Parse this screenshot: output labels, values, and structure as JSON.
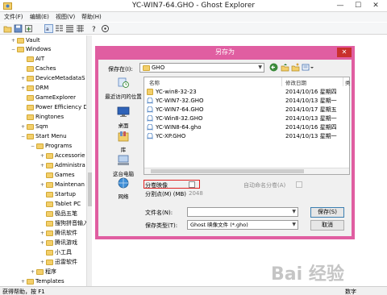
{
  "window": {
    "title": "YC-WIN7-64.GHO - Ghost Explorer",
    "minimize": "—",
    "maximize": "☐",
    "close": "✕"
  },
  "menu": [
    "文件(F)",
    "编辑(E)",
    "视图(V)",
    "帮助(H)"
  ],
  "toolbar_icons": [
    "open-icon",
    "save-icon",
    "extract-icon",
    "large-icons-icon",
    "small-icons-icon",
    "list-icon",
    "details-icon",
    "help-icon",
    "about-icon"
  ],
  "tree": [
    {
      "label": "Vault",
      "exp": "+",
      "indent": 1
    },
    {
      "label": "Windows",
      "exp": "−",
      "indent": 1
    },
    {
      "label": "AIT",
      "exp": "",
      "indent": 2
    },
    {
      "label": "Caches",
      "exp": "",
      "indent": 2
    },
    {
      "label": "DeviceMetadataS",
      "exp": "+",
      "indent": 2
    },
    {
      "label": "DRM",
      "exp": "+",
      "indent": 2
    },
    {
      "label": "GameExplorer",
      "exp": "",
      "indent": 2
    },
    {
      "label": "Power Efficiency D",
      "exp": "",
      "indent": 2
    },
    {
      "label": "Ringtones",
      "exp": "",
      "indent": 2
    },
    {
      "label": "Sqm",
      "exp": "+",
      "indent": 2
    },
    {
      "label": "Start Menu",
      "exp": "−",
      "indent": 2
    },
    {
      "label": "Programs",
      "exp": "−",
      "indent": 3
    },
    {
      "label": "Accessorie",
      "exp": "+",
      "indent": 4
    },
    {
      "label": "Administra",
      "exp": "+",
      "indent": 4
    },
    {
      "label": "Games",
      "exp": "",
      "indent": 4
    },
    {
      "label": "Maintenan",
      "exp": "+",
      "indent": 4
    },
    {
      "label": "Startup",
      "exp": "",
      "indent": 4
    },
    {
      "label": "Tablet PC",
      "exp": "",
      "indent": 4
    },
    {
      "label": "极品五笔",
      "exp": "",
      "indent": 4
    },
    {
      "label": "搜狗拼音输入",
      "exp": "",
      "indent": 4
    },
    {
      "label": "腾讯软件",
      "exp": "+",
      "indent": 4
    },
    {
      "label": "腾讯游戏",
      "exp": "+",
      "indent": 4
    },
    {
      "label": "小工具",
      "exp": "",
      "indent": 4
    },
    {
      "label": "迅雷软件",
      "exp": "+",
      "indent": 4
    },
    {
      "label": "程序",
      "exp": "+",
      "indent": 3
    },
    {
      "label": "Templates",
      "exp": "+",
      "indent": 2
    }
  ],
  "status": {
    "left": "获得帮助，按 F1",
    "right": "数字"
  },
  "dialog": {
    "title": "另存为",
    "close": "✕",
    "save_in_label": "保存在(I):",
    "save_in_value": "GHO",
    "places": [
      "最近访问的位置",
      "桌面",
      "库",
      "这台电脑",
      "网络"
    ],
    "columns": {
      "name": "名称",
      "date": "修改日期",
      "more": "类"
    },
    "files": [
      {
        "name": "YC-win8-32-23",
        "date": "2014/10/16 星期四",
        "type": "folder"
      },
      {
        "name": "YC-WIN7-32.GHO",
        "date": "2014/10/13 星期一",
        "type": "gho"
      },
      {
        "name": "YC-WIN7-64.GHO",
        "date": "2014/10/17 星期五",
        "type": "gho"
      },
      {
        "name": "YC-Win8-32.GHO",
        "date": "2014/10/13 星期一",
        "type": "gho"
      },
      {
        "name": "YC-WIN8-64.gho",
        "date": "2014/10/16 星期四",
        "type": "gho"
      },
      {
        "name": "YC-XP.GHO",
        "date": "2014/10/13 星期一",
        "type": "gho"
      }
    ],
    "split_image_label": "分卷映像",
    "split_size_label": "分割点(M) (MB)",
    "split_size_value": "2048",
    "auto_name_label": "自动命名分卷(A)",
    "filename_label": "文件名(N):",
    "filename_value": "",
    "filetype_label": "保存类型(T):",
    "filetype_value": "Ghost 映像文件 (*.gho)",
    "save_button": "保存(S)",
    "cancel_button": "取消"
  },
  "watermark": "Bai 经验"
}
